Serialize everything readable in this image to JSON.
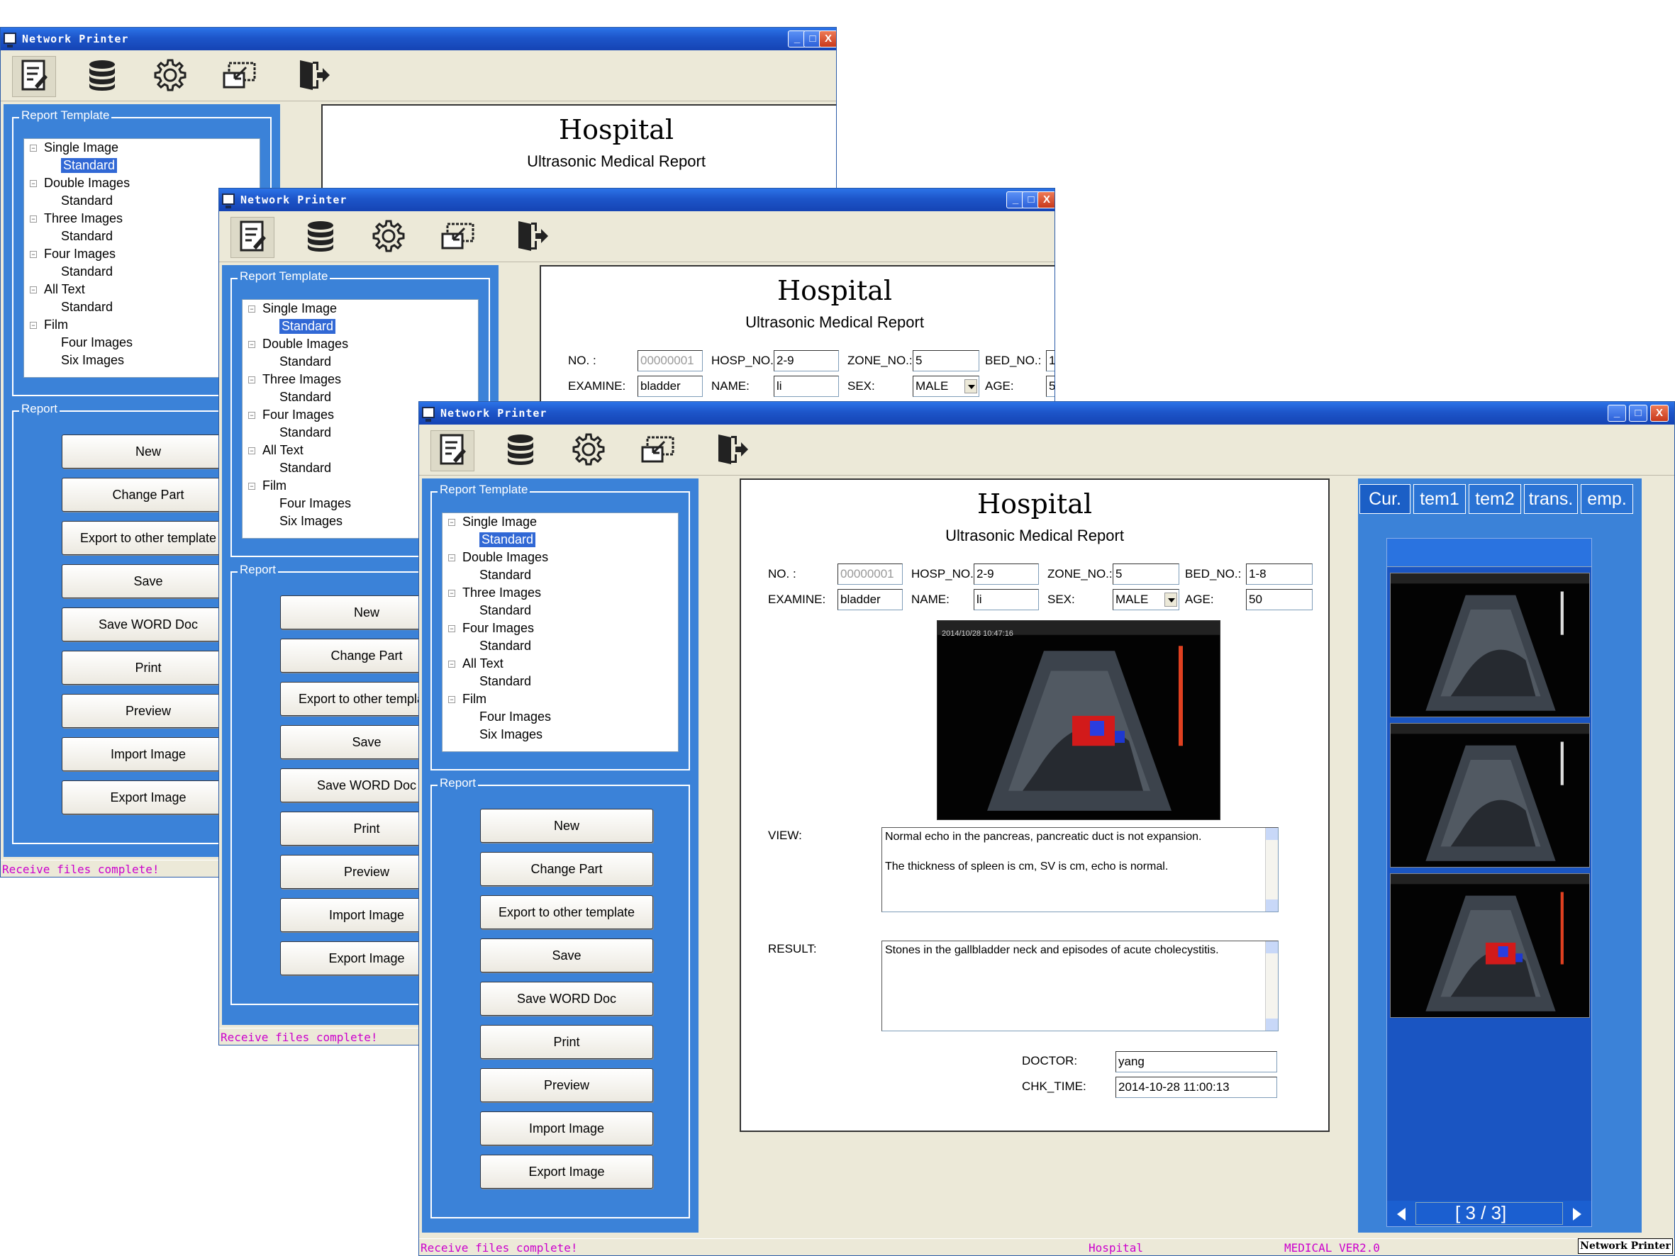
{
  "window": {
    "title": "Network Printer",
    "minimize": "_",
    "maximize": "□",
    "close": "X"
  },
  "toolbar": {
    "icons": [
      "report-edit-icon",
      "database-icon",
      "gear-icon",
      "import-screen-icon",
      "exit-door-icon"
    ]
  },
  "template_group": {
    "label": "Report Template",
    "tree": [
      {
        "label": "Single Image",
        "children": [
          "Standard"
        ]
      },
      {
        "label": "Double Images",
        "children": [
          "Standard"
        ]
      },
      {
        "label": "Three Images",
        "children": [
          "Standard"
        ]
      },
      {
        "label": "Four Images",
        "children": [
          "Standard"
        ]
      },
      {
        "label": "All Text",
        "children": [
          "Standard"
        ]
      },
      {
        "label": "Film",
        "children": [
          "Four Images",
          "Six Images"
        ]
      }
    ],
    "selected": "Single Image / Standard"
  },
  "report_group": {
    "label": "Report",
    "buttons": [
      "New",
      "Change Part",
      "Export to other template",
      "Save",
      "Save WORD Doc",
      "Print",
      "Preview",
      "Import Image",
      "Export Image"
    ]
  },
  "document": {
    "title": "Hospital",
    "subtitle": "Ultrasonic Medical Report",
    "fields": {
      "no_label": "NO. :",
      "no_value": "00000001",
      "hosp_label": "HOSP_NO.:",
      "hosp_value": "2-9",
      "zone_label": "ZONE_NO.:",
      "zone_value": "5",
      "bed_label": "BED_NO.:",
      "bed_value": "1-8",
      "examine_label": "EXAMINE:",
      "examine_value": "bladder",
      "name_label": "NAME:",
      "name_value": "li",
      "sex_label": "SEX:",
      "sex_value": "MALE",
      "age_label": "AGE:",
      "age_value": "50"
    },
    "view_label": "VIEW:",
    "view_text": [
      "Normal echo in the pancreas, pancreatic duct is not expansion.",
      "The thickness of spleen is  cm, SV is  cm, echo is normal."
    ],
    "result_label": "RESULT:",
    "result_text": "Stones in the gallbladder neck and episodes of acute cholecystitis.",
    "doctor_label": "DOCTOR:",
    "doctor_value": "yang",
    "chk_label": "CHK_TIME:",
    "chk_value": "2014-10-28 11:00:13",
    "image_timestamp": "2014/10/28 10:47:16"
  },
  "image_tabs": [
    "Cur.",
    "tem1",
    "tem2",
    "trans.",
    "emp."
  ],
  "pager": {
    "text": "[ 3 /  3]"
  },
  "status": {
    "message": "Receive files complete!",
    "hospital": "Hospital",
    "version": "MEDICAL VER2.0",
    "taskbar_label": "Network Printer"
  },
  "colors": {
    "panel_blue": "#3b82d8",
    "title_blue": "#1d55c9",
    "status_magenta": "#cc00cc"
  }
}
